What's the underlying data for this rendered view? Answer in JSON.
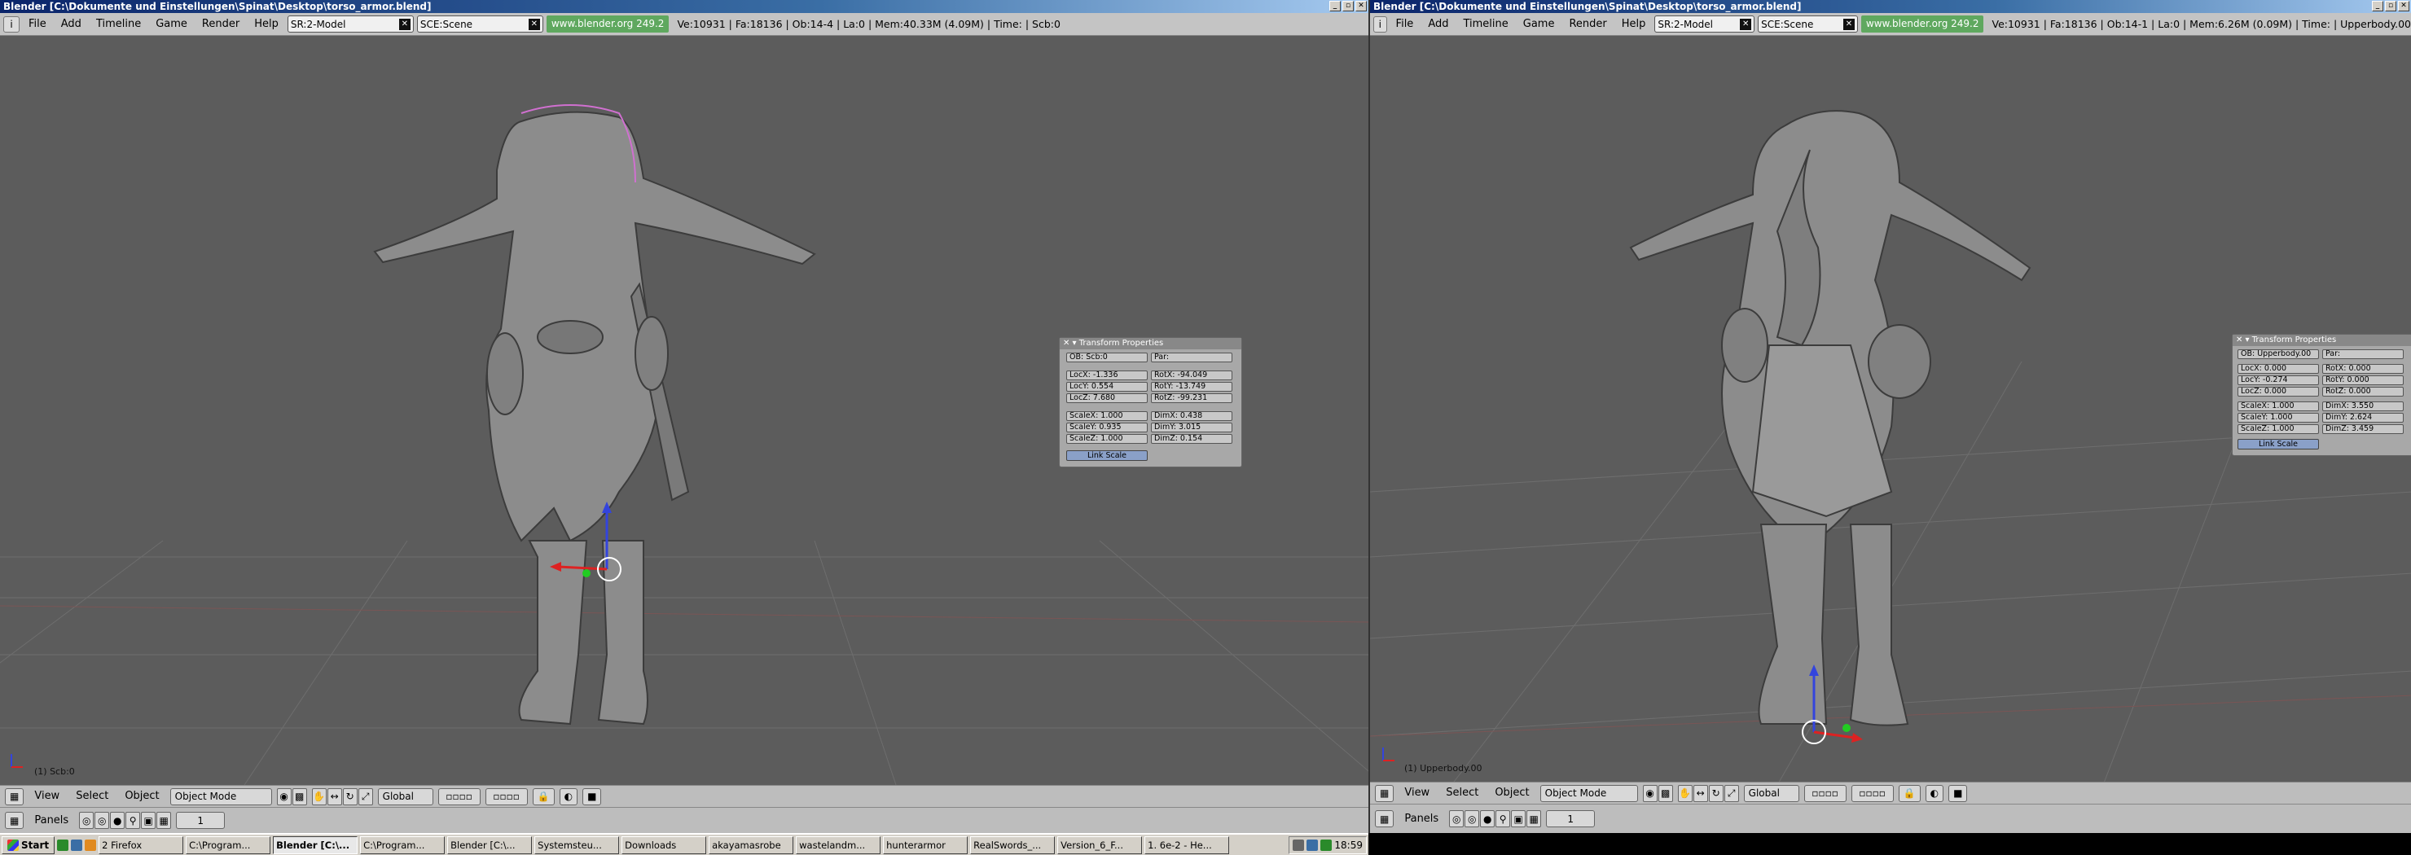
{
  "left": {
    "title": "Blender [C:\\Dokumente und Einstellungen\\Spinat\\Desktop\\torso_armor.blend]",
    "menus": [
      "File",
      "Add",
      "Timeline",
      "Game",
      "Render",
      "Help"
    ],
    "screen": "SR:2-Model",
    "scene": "SCE:Scene",
    "url": "www.blender.org 249.2",
    "stats": "Ve:10931 | Fa:18136 | Ob:14-4 | La:0  | Mem:40.33M (4.09M)  | Time: | Scb:0",
    "viewport_label": "(1) Scb:0",
    "header": {
      "view": "View",
      "select": "Select",
      "object": "Object",
      "mode": "Object Mode",
      "orientation": "Global",
      "frame": "1",
      "panels": "Panels"
    },
    "transform": {
      "title": "Transform Properties",
      "ob": "OB: Scb:0",
      "par": "Par:",
      "locx": "LocX: -1.336",
      "locy": "LocY: 0.554",
      "locz": "LocZ: 7.680",
      "rotx": "RotX: -94.049",
      "roty": "RotY: -13.749",
      "rotz": "RotZ: -99.231",
      "scalex": "ScaleX: 1.000",
      "scaley": "ScaleY: 0.935",
      "scalez": "ScaleZ: 1.000",
      "dimx": "DimX: 0.438",
      "dimy": "DimY: 3.015",
      "dimz": "DimZ: 0.154",
      "link_scale": "Link Scale"
    }
  },
  "right": {
    "title": "Blender [C:\\Dokumente und Einstellungen\\Spinat\\Desktop\\torso_armor.blend]",
    "menus": [
      "File",
      "Add",
      "Timeline",
      "Game",
      "Render",
      "Help"
    ],
    "screen": "SR:2-Model",
    "scene": "SCE:Scene",
    "url": "www.blender.org 249.2",
    "stats": "Ve:10931 | Fa:18136 | Ob:14-1 | La:0  | Mem:6.26M (0.09M)  | Time: | Upperbody.00",
    "viewport_label": "(1) Upperbody.00",
    "header": {
      "view": "View",
      "select": "Select",
      "object": "Object",
      "mode": "Object Mode",
      "orientation": "Global",
      "frame": "1",
      "panels": "Panels"
    },
    "transform": {
      "title": "Transform Properties",
      "ob": "OB: Upperbody.00",
      "par": "Par:",
      "locx": "LocX: 0.000",
      "locy": "LocY: -0.274",
      "locz": "LocZ: 0.000",
      "rotx": "RotX: 0.000",
      "roty": "RotY: 0.000",
      "rotz": "RotZ: 0.000",
      "scalex": "ScaleX: 1.000",
      "scaley": "ScaleY: 1.000",
      "scalez": "ScaleZ: 1.000",
      "dimx": "DimX: 3.550",
      "dimy": "DimY: 2.624",
      "dimz": "DimZ: 3.459",
      "link_scale": "Link Scale"
    }
  },
  "taskbar": {
    "start": "Start",
    "tasks": [
      "2 Firefox",
      "C:\\Program...",
      "Blender [C:\\...",
      "C:\\Program...",
      "Blender [C:\\...",
      "Systemsteu...",
      "Downloads",
      "akayamasrobe",
      "wastelandm...",
      "hunterarmor",
      "RealSwords_...",
      "Version_6_F...",
      "1. 6e-2 - He..."
    ],
    "clock": "18:59"
  }
}
